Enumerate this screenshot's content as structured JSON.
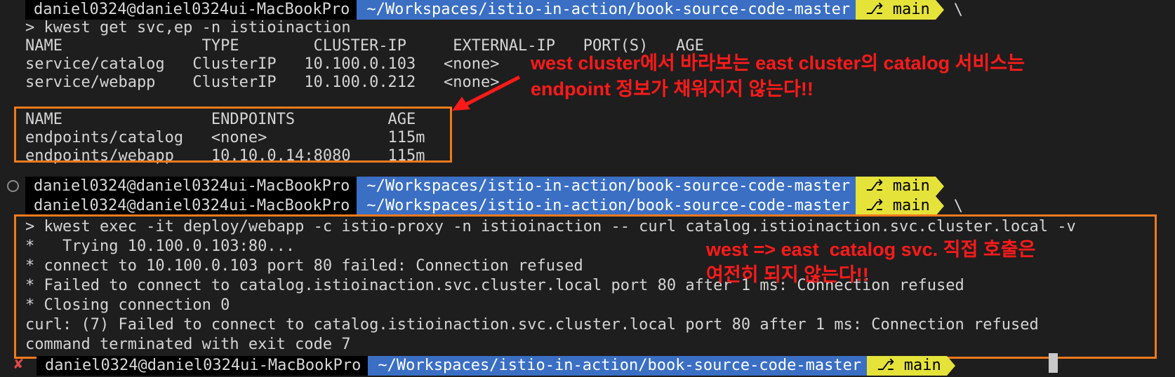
{
  "prompt": {
    "user": "daniel0324@daniel0324ui-MacBookPro",
    "path": "~/Workspaces/istio-in-action/book-source-code-master",
    "branch": "main",
    "continuation": "\\",
    "git_icon": "branch-icon"
  },
  "block1": {
    "command": "> kwest get svc,ep -n istioinaction",
    "svc_header": "NAME               TYPE        CLUSTER-IP     EXTERNAL-IP   PORT(S)   AGE",
    "svc_rows": [
      "service/catalog   ClusterIP   10.100.0.103   <none>",
      "service/webapp    ClusterIP   10.100.0.212   <none>"
    ],
    "ep_header": "NAME                ENDPOINTS          AGE",
    "ep_rows": [
      "endpoints/catalog   <none>             115m",
      "endpoints/webapp    10.10.0.14:8080    115m"
    ]
  },
  "block2": {
    "command": "> kwest exec -it deploy/webapp -c istio-proxy -n istioinaction -- curl catalog.istioinaction.svc.cluster.local -v",
    "output": [
      "*   Trying 10.100.0.103:80...",
      "* connect to 10.100.0.103 port 80 failed: Connection refused",
      "* Failed to connect to catalog.istioinaction.svc.cluster.local port 80 after 1 ms: Connection refused",
      "* Closing connection 0",
      "curl: (7) Failed to connect to catalog.istioinaction.svc.cluster.local port 80 after 1 ms: Connection refused",
      "command terminated with exit code 7"
    ]
  },
  "annotations": {
    "top_line1": "west cluster에서 바라보는 east cluster의 catalog 서비스는",
    "top_line2": "endpoint 정보가 채워지지 않는다!!",
    "bottom_line1": "west => east  catalog svc. 직접 호출은",
    "bottom_line2": "여전히 되지 않는다!!"
  },
  "colors": {
    "background": "#1e1e1e",
    "path_segment": "#3a6fc4",
    "git_segment": "#e5e33a",
    "highlight_box": "#f07a1c",
    "annotation_text": "#ff1a1a",
    "error_mark": "#e04848"
  }
}
